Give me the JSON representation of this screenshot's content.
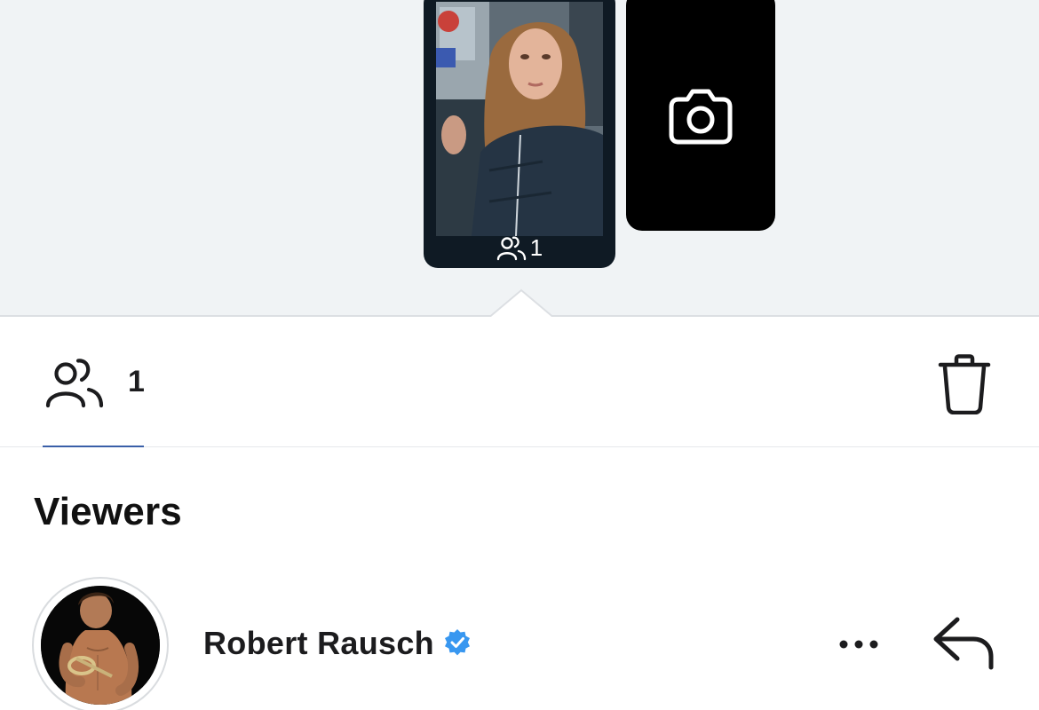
{
  "story_strip": {
    "story_thumbnail": {
      "view_count": "1",
      "icon": "people-icon"
    },
    "camera_tile": {
      "icon": "camera-icon"
    }
  },
  "toolbar": {
    "viewers_tab": {
      "icon": "people-icon",
      "count": "1",
      "selected": true
    },
    "delete_icon": "trash-icon"
  },
  "viewers_section": {
    "title": "Viewers",
    "viewers": [
      {
        "name": "Robert Rausch",
        "verified": true,
        "more_icon": "ellipsis-icon",
        "reply_icon": "reply-arrow-icon"
      }
    ]
  },
  "colors": {
    "strip_background": "#f0f3f5",
    "tab_underline": "#3a5fa8",
    "verified_badge": "#3897f0",
    "text": "#1c1c1e"
  }
}
